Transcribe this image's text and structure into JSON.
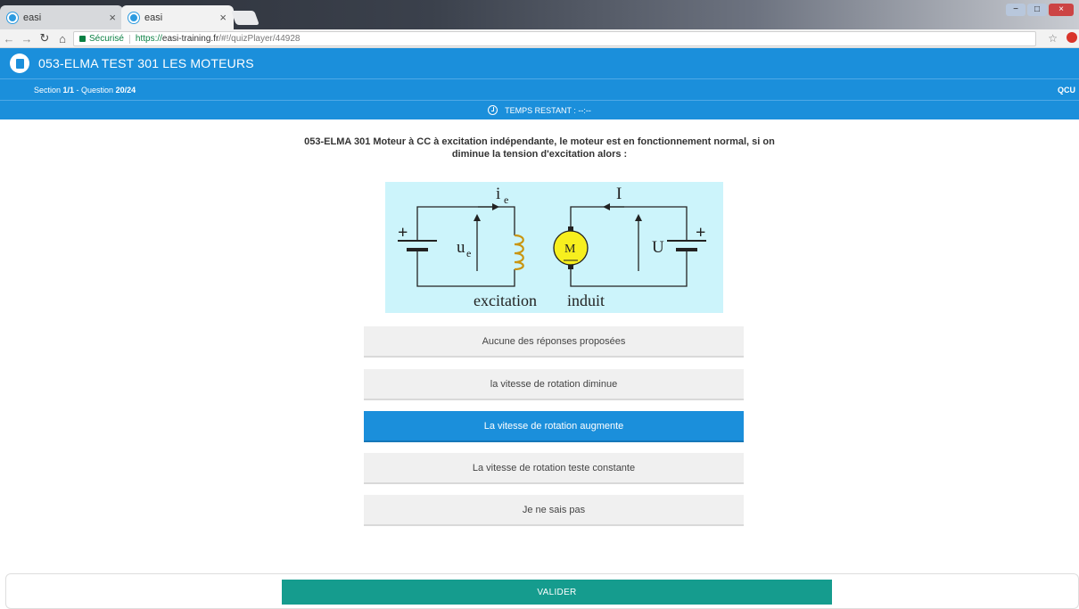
{
  "browser": {
    "tabs": [
      {
        "title": "easi"
      },
      {
        "title": "easi"
      }
    ],
    "address": {
      "secure_label": "Sécurisé",
      "url_scheme": "https://",
      "url_host": "easi-training.fr",
      "url_path": "/#!/quizPlayer/44928"
    }
  },
  "app": {
    "title": "053-ELMA TEST 301 LES MOTEURS"
  },
  "progress": {
    "section_label": "Section ",
    "section_value": "1/1",
    "question_label": " - Question ",
    "question_value": "20/24",
    "type": "QCU"
  },
  "timer": {
    "label": "TEMPS RESTANT : --:--"
  },
  "question": {
    "text": "053-ELMA 301 Moteur à CC à excitation indépendante, le moteur est en fonctionnement normal, si on diminue la tension d'excitation alors :"
  },
  "diagram": {
    "label_ie_main": "i",
    "label_ie_sub": "e",
    "label_ue_main": "u",
    "label_ue_sub": "e",
    "label_I": "I",
    "label_U": "U",
    "motor_label": "M",
    "caption_left": "excitation",
    "caption_right": "induit",
    "plus_left": "+",
    "plus_right": "+",
    "colors": {
      "background": "#ccf4fb",
      "motor_fill": "#f7ef1e",
      "coil": "#f2c230"
    }
  },
  "answers": [
    {
      "label": "Aucune des réponses proposées",
      "selected": false
    },
    {
      "label": "la vitesse de rotation diminue",
      "selected": false
    },
    {
      "label": "La vitesse de rotation augmente",
      "selected": true
    },
    {
      "label": "La vitesse de rotation teste constante",
      "selected": false
    },
    {
      "label": "Je ne sais pas",
      "selected": false
    }
  ],
  "actions": {
    "submit_label": "VALIDER"
  },
  "colors": {
    "primary": "#1b8fdb",
    "submit": "#159c8e"
  }
}
